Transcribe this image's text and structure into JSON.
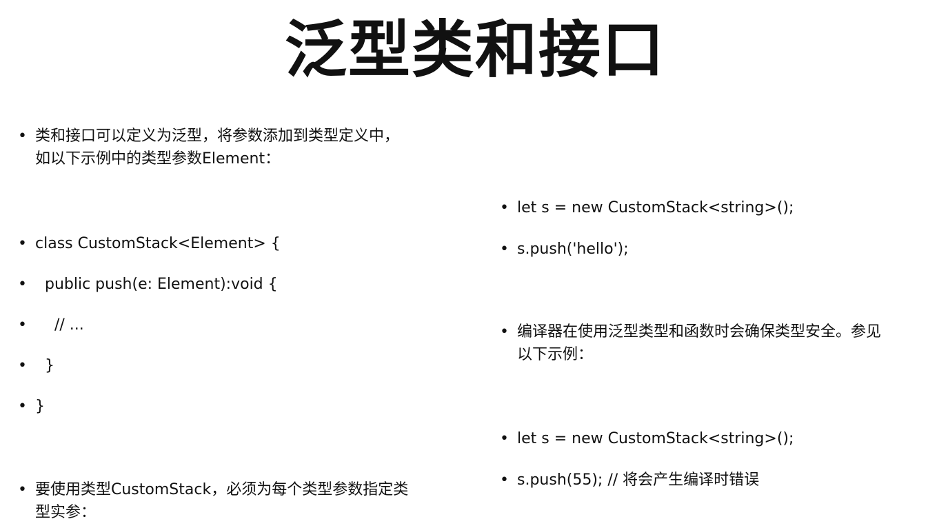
{
  "slide": {
    "title": "泛型类和接口",
    "left_column": [
      {
        "lines": [
          "类和接口可以定义为泛型，将参数添加到类型定义中，",
          "如以下示例中的类型参数Element："
        ]
      },
      {
        "lines": [
          "class CustomStack<Element> {"
        ]
      },
      {
        "lines": [
          "  public push(e: Element):void {"
        ]
      },
      {
        "lines": [
          "    // ..."
        ]
      },
      {
        "lines": [
          "  }"
        ]
      },
      {
        "lines": [
          "}"
        ]
      },
      {
        "lines": [
          "要使用类型CustomStack，必须为每个类型参数指定类",
          "型实参："
        ]
      }
    ],
    "right_column": [
      {
        "lines": [
          "let s = new CustomStack<string>();"
        ]
      },
      {
        "lines": [
          "s.push('hello');"
        ]
      },
      {
        "lines": [
          "编译器在使用泛型类型和函数时会确保类型安全。参见",
          "以下示例："
        ]
      },
      {
        "lines": [
          "let s = new CustomStack<string>();"
        ]
      },
      {
        "lines": [
          "s.push(55); // 将会产生编译时错误"
        ]
      }
    ],
    "bullet_glyph": "•"
  }
}
